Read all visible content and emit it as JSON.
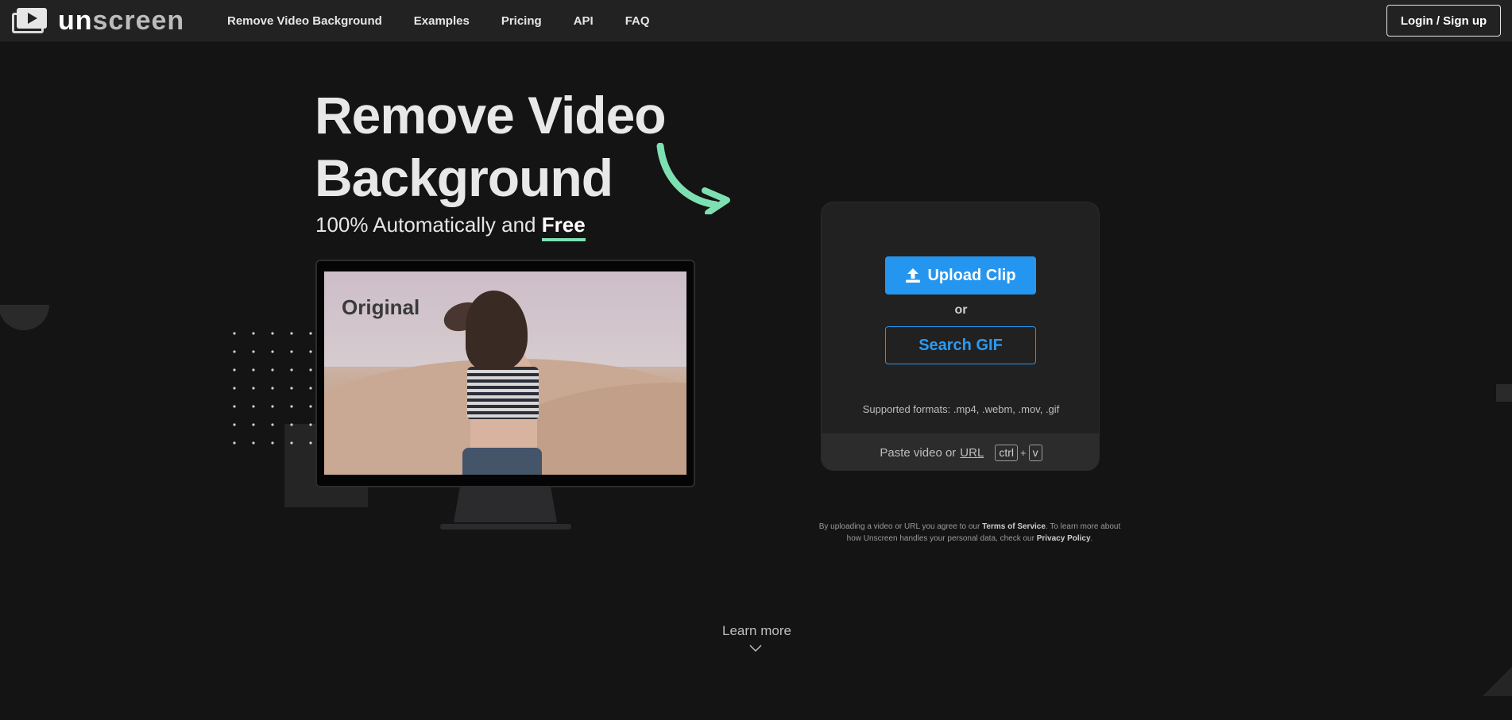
{
  "brand": {
    "name_part1": "un",
    "name_part2": "screen",
    "logo_icon": "play-icon"
  },
  "nav": {
    "links": [
      "Remove Video Background",
      "Examples",
      "Pricing",
      "API",
      "FAQ"
    ],
    "login_label": "Login / Sign up"
  },
  "hero": {
    "title": "Remove Video Background",
    "subtitle_prefix": "100% Automatically and",
    "subtitle_free": "Free",
    "accent_color": "#7ee0b2"
  },
  "preview": {
    "label": "Original"
  },
  "upload": {
    "upload_label": "Upload Clip",
    "upload_icon": "upload-icon",
    "or_label": "or",
    "search_gif_label": "Search GIF",
    "formats": "Supported formats: .mp4, .webm, .mov, .gif",
    "paste_prefix": "Paste video or",
    "paste_url": "URL",
    "kbd_ctrl": "ctrl",
    "kbd_plus": "+",
    "kbd_v": "v",
    "primary_color": "#2596f0"
  },
  "terms": {
    "part1": "By uploading a video or URL you agree to our",
    "tos_link": "Terms of Service",
    "part2": ". To learn more about how Unscreen handles your personal data, check our",
    "privacy_link": "Privacy Policy",
    "part3": "."
  },
  "footer": {
    "learn_more": "Learn more",
    "chevron_icon": "chevron-down-icon"
  }
}
